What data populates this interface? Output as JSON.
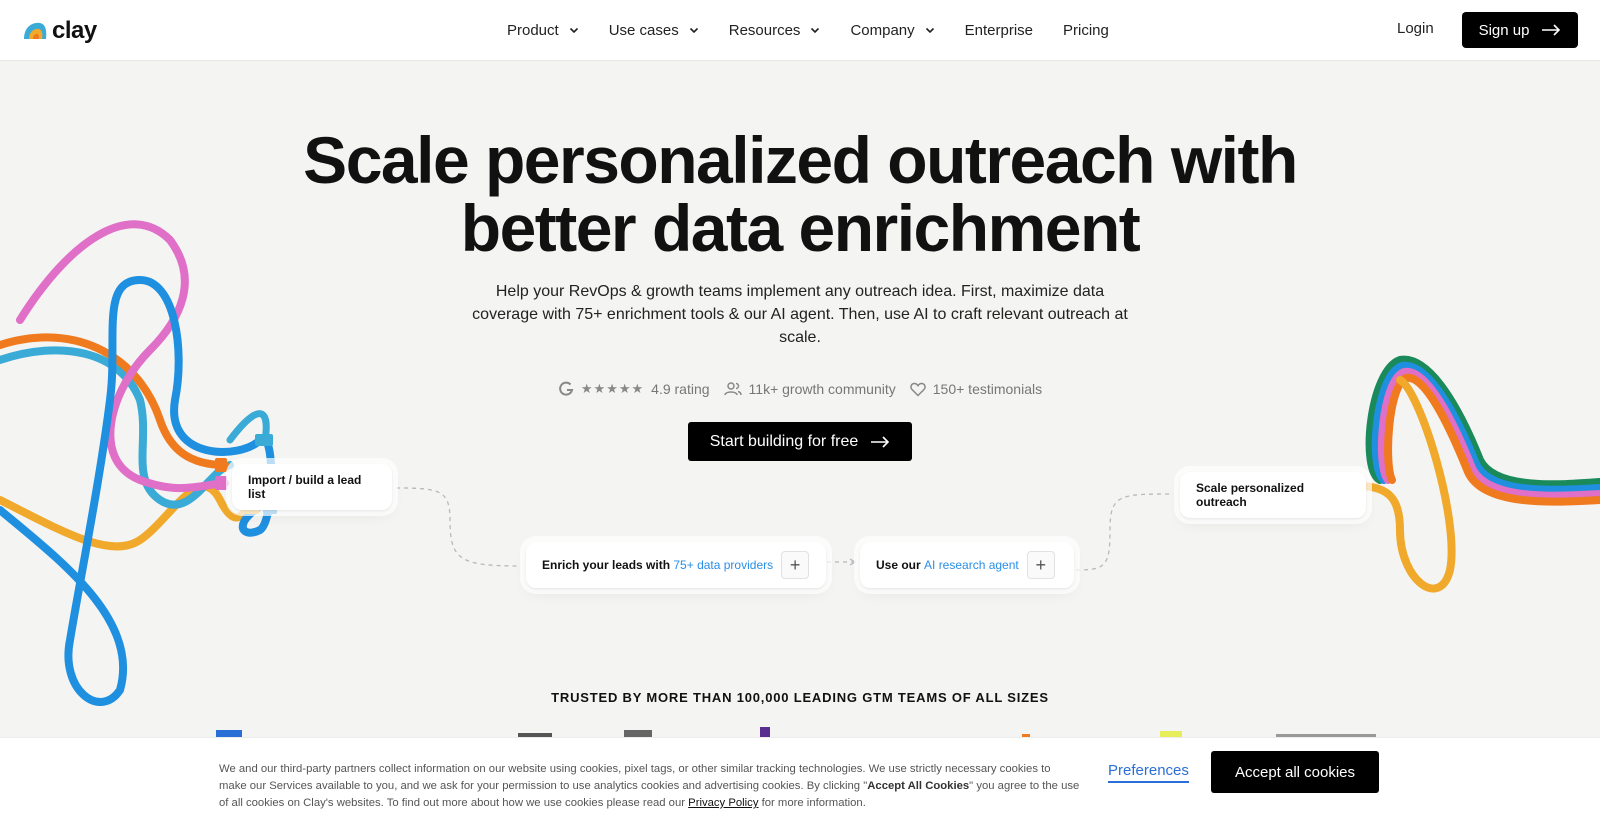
{
  "brand": {
    "name": "clay"
  },
  "nav": {
    "items": [
      {
        "label": "Product",
        "has_dropdown": true
      },
      {
        "label": "Use cases",
        "has_dropdown": true
      },
      {
        "label": "Resources",
        "has_dropdown": true
      },
      {
        "label": "Company",
        "has_dropdown": true
      },
      {
        "label": "Enterprise",
        "has_dropdown": false
      },
      {
        "label": "Pricing",
        "has_dropdown": false
      }
    ],
    "login": "Login",
    "signup": "Sign up"
  },
  "hero": {
    "title_line1": "Scale personalized outreach with",
    "title_line2": "better data enrichment",
    "subtitle": "Help your RevOps & growth teams implement any outreach idea. First, maximize data coverage with 75+ enrichment tools & our AI agent. Then, use AI to craft relevant outreach at scale.",
    "stats": {
      "rating": "4.9 rating",
      "community": "11k+ growth community",
      "testimonials": "150+ testimonials"
    },
    "cta": "Start building for free"
  },
  "flow": {
    "import": "Import / build a lead list",
    "enrich_prefix": "Enrich your leads with ",
    "enrich_link": "75+ data providers",
    "agent_prefix": "Use our ",
    "agent_link": "AI research agent",
    "outreach": "Scale personalized outreach"
  },
  "trusted": "TRUSTED BY MORE THAN 100,000 LEADING GTM TEAMS OF ALL SIZES",
  "cookie": {
    "text_part1": "We and our third-party partners collect information on our website using cookies, pixel tags, or other similar tracking technologies. We use strictly necessary cookies to make our Services available to you, and we ask for your permission to use analytics cookies and advertising cookies. By clicking \"",
    "text_bold": "Accept All Cookies",
    "text_part2": "\" you agree to the use of all cookies on Clay's websites. To find out more about how we use cookies please read our ",
    "privacy_link": "Privacy Policy",
    "text_part3": " for more information.",
    "preferences": "Preferences",
    "accept": "Accept all cookies"
  },
  "colors": {
    "accent_blue": "#2a8fe6",
    "cable_pink": "#e06fc8",
    "cable_orange": "#f07a1e",
    "cable_blue": "#1f8fe0",
    "cable_teal": "#3aaad6",
    "cable_yellow": "#f0a92a",
    "cable_green": "#1a8a5a"
  }
}
